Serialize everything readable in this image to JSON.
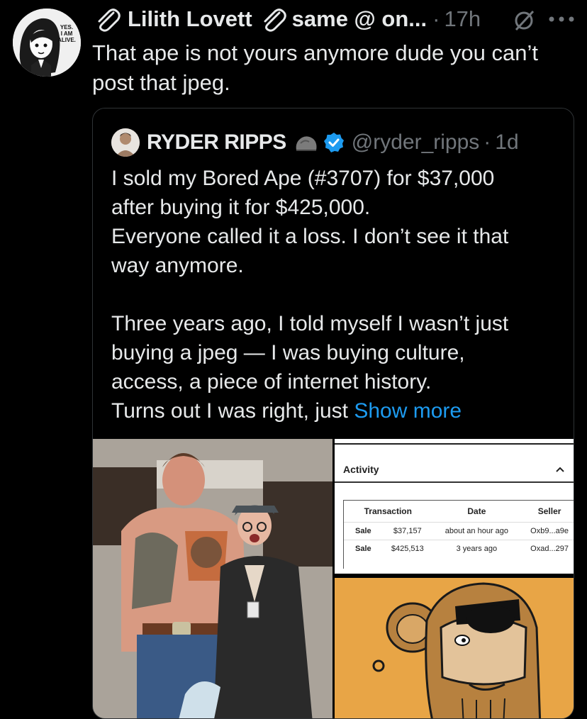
{
  "tweet": {
    "display_name": "Lilith Lovett",
    "handle": "same @ on...",
    "separator": "·",
    "time": "17h",
    "text_line1": "That ape is not yours anymore dude you can’t",
    "text_line2": "post that jpeg.",
    "avatar_text": [
      "YES.",
      "I AM",
      "ALIVE."
    ]
  },
  "quote": {
    "display_name": "RYDER RIPPS",
    "handle": "@ryder_ripps",
    "separator": "·",
    "time": "1d",
    "lines": [
      "I sold my Bored Ape (#3707) for $37,000",
      "after buying it for $425,000.",
      "Everyone called it a loss. I don’t see it that",
      "way anymore.",
      "",
      "Three years ago, I told myself I wasn’t just",
      "buying a jpeg — I was buying culture,",
      "access, a piece of internet history."
    ],
    "last_line_prefix": "Turns out I was right, just ",
    "show_more": "Show more"
  },
  "activity": {
    "title": "Activity",
    "columns": [
      "Transaction",
      "Date",
      "Seller"
    ],
    "rows": [
      {
        "type": "Sale",
        "price": "$37,157",
        "date": "about an hour ago",
        "seller": "Oxb9...a9e"
      },
      {
        "type": "Sale",
        "price": "$425,513",
        "date": "3 years ago",
        "seller": "Oxad...297"
      }
    ]
  },
  "colors": {
    "background": "#000000",
    "text": "#e7e9ea",
    "muted": "#71767b",
    "link": "#1d9bf0",
    "verified": "#1d9bf0",
    "ape_bg": "#e8a546"
  }
}
